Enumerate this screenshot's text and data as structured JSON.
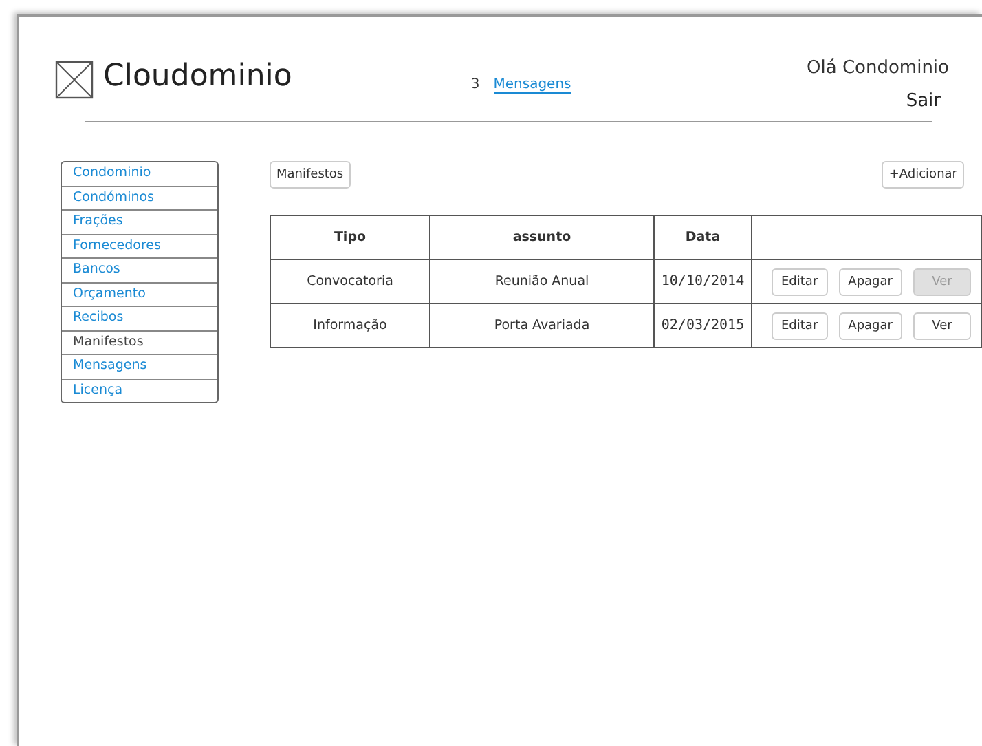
{
  "header": {
    "title": "Cloudominio",
    "message_count": "3",
    "messages_link": "Mensagens",
    "greeting": "Olá Condominio",
    "logout": "Sair"
  },
  "sidebar": {
    "items": [
      {
        "label": "Condominio",
        "selected": false
      },
      {
        "label": "Condóminos",
        "selected": false
      },
      {
        "label": "Frações",
        "selected": false
      },
      {
        "label": "Fornecedores",
        "selected": false
      },
      {
        "label": "Bancos",
        "selected": false
      },
      {
        "label": "Orçamento",
        "selected": false
      },
      {
        "label": "Recibos",
        "selected": false
      },
      {
        "label": "Manifestos",
        "selected": true
      },
      {
        "label": "Mensagens",
        "selected": false
      },
      {
        "label": "Licença",
        "selected": false
      }
    ]
  },
  "toolbar": {
    "section_button": "Manifestos",
    "add_button": "+Adicionar"
  },
  "table": {
    "columns": [
      "Tipo",
      "assunto",
      "Data"
    ],
    "rows": [
      {
        "cells": [
          "Convocatoria",
          "Reunião Anual",
          "10/10/2014"
        ],
        "actions": [
          {
            "label": "Editar",
            "disabled": false
          },
          {
            "label": "Apagar",
            "disabled": false
          },
          {
            "label": "Ver",
            "disabled": true
          }
        ]
      },
      {
        "cells": [
          "Informação",
          "Porta Avariada",
          "02/03/2015"
        ],
        "actions": [
          {
            "label": "Editar",
            "disabled": false
          },
          {
            "label": "Apagar",
            "disabled": false
          },
          {
            "label": "Ver",
            "disabled": false
          }
        ]
      }
    ]
  }
}
